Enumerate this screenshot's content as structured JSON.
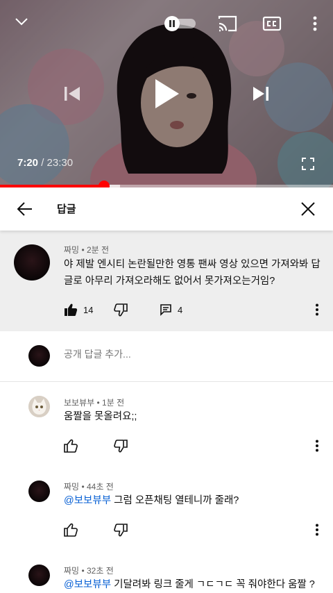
{
  "player": {
    "current_time": "7:20",
    "total_time": "/ 23:30",
    "progress": 0.313,
    "buffered": 0.36,
    "colors": {
      "progress": "#ff0000"
    }
  },
  "replies": {
    "title": "답글"
  },
  "parent_comment": {
    "author": "짜밍",
    "time": "• 2분 전",
    "text_line1": "야 제발 엔시티 논란될만한 영통 팬싸 영상 있으면 가져와봐 답",
    "text_line2": "글로 아무리 가져오라해도 없어서 못가져오는거임?",
    "likes": "14",
    "replies_count": "4"
  },
  "add_reply": {
    "placeholder": "공개 답글 추가..."
  },
  "reply_list": [
    {
      "author": "보보뷰부",
      "time": "• 1분 전",
      "mention": "",
      "text": "움짤을 못올려요;;"
    },
    {
      "author": "짜밍",
      "time": "• 44초 전",
      "mention": "@보보뷰부",
      "text": " 그럼 오픈채팅 열테니까 줄래?"
    },
    {
      "author": "짜밍",
      "time": "• 32초 전",
      "mention": "@보보뷰부",
      "text": " 기달려봐 링크 줄게 ㄱㄷㄱㄷ 꼭 줘야한다 움짤 ?"
    }
  ],
  "icons": {
    "collapse": "chevron-down-icon",
    "autoplay": "autoplay-toggle-icon",
    "cast": "cast-icon",
    "captions": "captions-icon",
    "more": "more-vert-icon",
    "prev": "skip-previous-icon",
    "play": "play-icon",
    "next": "skip-next-icon",
    "fullscreen": "fullscreen-icon",
    "back": "arrow-back-icon",
    "close": "close-icon",
    "like": "thumb-up-icon",
    "dislike": "thumb-down-icon",
    "reply": "reply-icon"
  }
}
